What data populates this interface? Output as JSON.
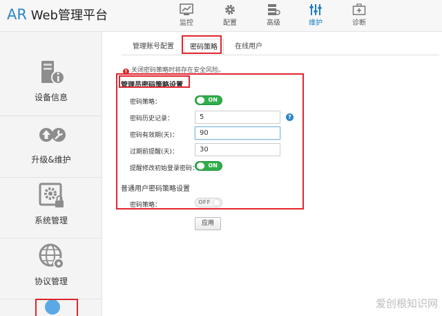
{
  "header": {
    "logo_ar": "AR",
    "logo_text": "Web管理平台",
    "nav": [
      {
        "label": "监控",
        "icon": "monitor-chart-icon"
      },
      {
        "label": "配置",
        "icon": "gear-icon"
      },
      {
        "label": "高级",
        "icon": "advanced-server-icon"
      },
      {
        "label": "维护",
        "icon": "sliders-icon"
      },
      {
        "label": "诊断",
        "icon": "medical-kit-icon"
      }
    ],
    "active_nav": "维护",
    "accent_color": "#1f7fc4"
  },
  "sidebar": {
    "items": [
      {
        "label": "设备信息",
        "icon": "device-info-icon"
      },
      {
        "label": "升级&维护",
        "icon": "upgrade-maintain-icon"
      },
      {
        "label": "系统管理",
        "icon": "system-manage-icon"
      },
      {
        "label": "协议管理",
        "icon": "protocol-globe-icon"
      }
    ]
  },
  "tabs": [
    {
      "label": "管理账号配置"
    },
    {
      "label": "密码策略"
    },
    {
      "label": "在线用户"
    }
  ],
  "warning": "关闭密码策略时将存在安全风险。",
  "admin_section": {
    "title": "管理员密码策略设置",
    "rows": [
      {
        "label": "密码策略：",
        "toggle": "ON"
      },
      {
        "label": "密码历史记录：",
        "value": "5"
      },
      {
        "label": "密码有效期(天)：",
        "value": "90"
      },
      {
        "label": "过期前提醒(天)：",
        "value": "30"
      },
      {
        "label": "提醒修改初始登录密码：",
        "toggle": "ON"
      }
    ]
  },
  "user_section": {
    "title": "普通用户密码策略设置",
    "rows": [
      {
        "label": "密码策略：",
        "toggle": "OFF"
      }
    ]
  },
  "apply_label": "应用",
  "help_glyph": "?",
  "warn_glyph": "!",
  "watermark": "爱创根知识网",
  "colors": {
    "on": "#2fae49",
    "highlight": "#e0242c",
    "help": "#2b86c8"
  }
}
